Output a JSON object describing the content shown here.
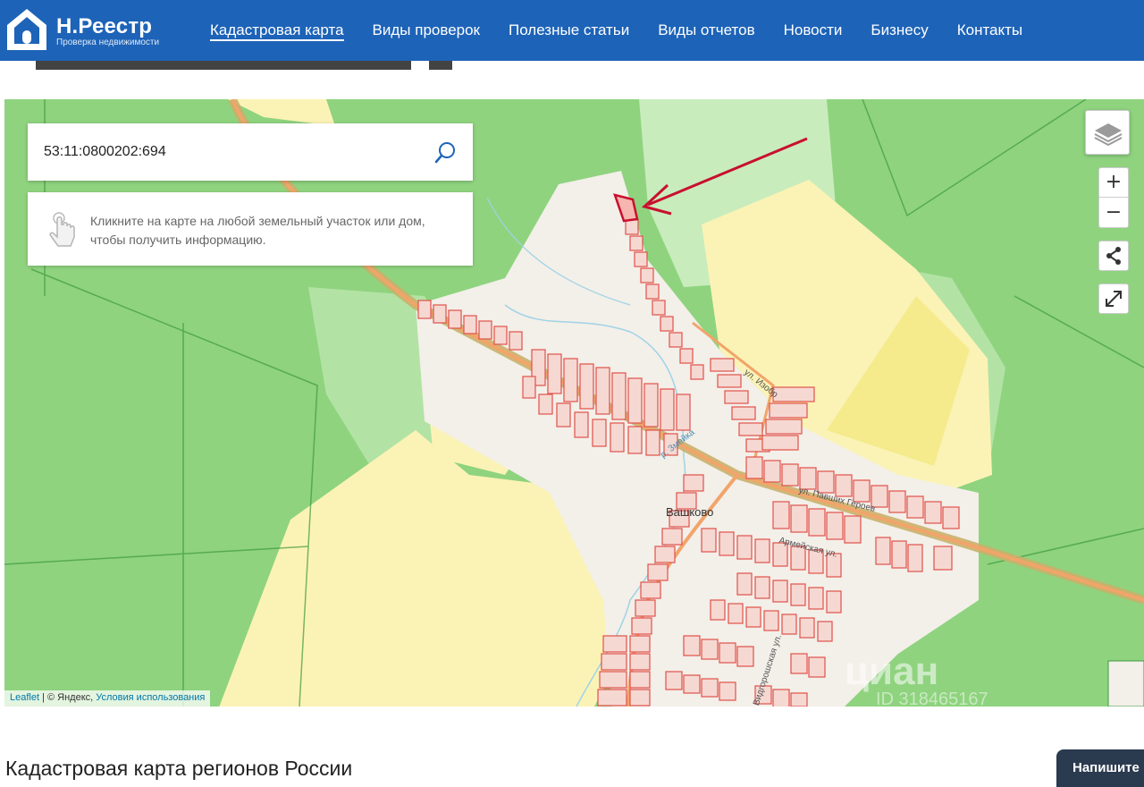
{
  "header": {
    "logo_title": "Н.Реестр",
    "logo_subtitle": "Проверка недвижимости",
    "nav": [
      {
        "label": "Кадастровая карта",
        "active": true
      },
      {
        "label": "Виды проверок"
      },
      {
        "label": "Полезные статьи"
      },
      {
        "label": "Виды отчетов"
      },
      {
        "label": "Новости"
      },
      {
        "label": "Бизнесу"
      },
      {
        "label": "Контакты"
      }
    ]
  },
  "page": {
    "bottom_heading": "Кадастровая карта регионов России",
    "chat_button": "Напишите"
  },
  "map": {
    "search_value": "53:11:0800202:694",
    "hint": "Кликните на карте на любой земельный участок или дом, чтобы получить информацию.",
    "labels": {
      "village": "Вашково",
      "river": "р. Змейка",
      "street_1": "ул. Павших Героев",
      "street_2": "Армейская ул.",
      "street_3": "ул. Изобр",
      "street_4": "Видгорошская ул."
    },
    "controls": {
      "zoom_in": "+",
      "zoom_out": "−"
    },
    "attribution": {
      "leaflet": "Leaflet",
      "separator": " | © Яндекс, ",
      "terms": "Условия использования"
    },
    "watermark": "циан",
    "watermark_id": "ID 318465167"
  },
  "colors": {
    "header": "#1d63b8",
    "forest": "#8fd37f",
    "field": "#fbf3b5",
    "parcel_outline": "#e0524a",
    "parcel_fill": "#f6d8d2",
    "road": "#f2a46a",
    "arrow": "#c8102e"
  }
}
